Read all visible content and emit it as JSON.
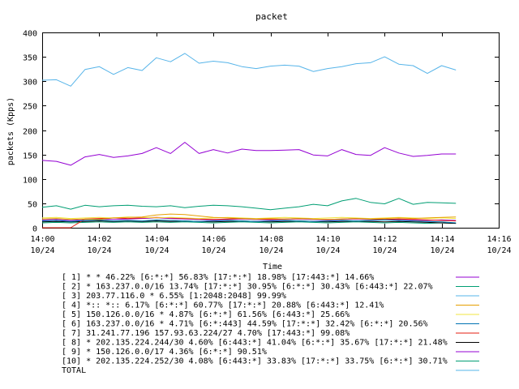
{
  "chart_data": {
    "type": "line",
    "title": "packet",
    "xlabel": "Time",
    "ylabel": "packets (Kpps)",
    "ylim": [
      0,
      400
    ],
    "yticks": [
      "0",
      "50",
      "100",
      "150",
      "200",
      "250",
      "300",
      "350",
      "400"
    ],
    "xticks": [
      {
        "time": "14:00",
        "date": "10/24"
      },
      {
        "time": "14:02",
        "date": "10/24"
      },
      {
        "time": "14:04",
        "date": "10/24"
      },
      {
        "time": "14:06",
        "date": "10/24"
      },
      {
        "time": "14:08",
        "date": "10/24"
      },
      {
        "time": "14:10",
        "date": "10/24"
      },
      {
        "time": "14:12",
        "date": "10/24"
      },
      {
        "time": "14:14",
        "date": "10/24"
      },
      {
        "time": "14:16",
        "date": "10/24"
      }
    ],
    "x_minutes": [
      0,
      0.5,
      1,
      1.5,
      2,
      2.5,
      3,
      3.5,
      4,
      4.5,
      5,
      5.5,
      6,
      6.5,
      7,
      7.5,
      8,
      8.5,
      9,
      9.5,
      10,
      10.5,
      11,
      11.5,
      12,
      12.5,
      13,
      13.5,
      14,
      14.5
    ],
    "series": [
      {
        "name": "[ 1] * * 46.22%  [6:*:*] 56.83% [17:*:*] 18.98% [17:443:*] 14.66%",
        "color": "#9400d3",
        "values": [
          138,
          136,
          128,
          145,
          150,
          144,
          147,
          152,
          164,
          152,
          175,
          152,
          160,
          153,
          161,
          158,
          158,
          159,
          160,
          149,
          147,
          160,
          150,
          148,
          164,
          153,
          146,
          148,
          151,
          151
        ]
      },
      {
        "name": "[ 2] * 163.237.0.0/16 13.74%  [17:*:*] 30.95% [6:*:*] 30.43% [6:443:*] 22.07%",
        "color": "#009e73",
        "values": [
          42,
          45,
          38,
          46,
          43,
          45,
          46,
          44,
          43,
          45,
          41,
          44,
          46,
          45,
          43,
          40,
          37,
          40,
          43,
          48,
          45,
          55,
          60,
          52,
          49,
          60,
          48,
          52,
          51,
          50
        ]
      },
      {
        "name": "[ 3] 203.77.116.0 * 6.55%  [1:2048:2048] 99.99%",
        "color": "#56b4e9",
        "values": [
          302,
          303,
          290,
          324,
          330,
          314,
          328,
          322,
          348,
          340,
          357,
          337,
          341,
          338,
          330,
          326,
          331,
          333,
          331,
          320,
          326,
          330,
          336,
          338,
          350,
          335,
          332,
          316,
          332,
          323
        ]
      },
      {
        "name": "[ 4] *:: *:: 6.17%  [6:*:*] 60.77% [17:*:*] 20.88% [6:443:*] 12.41%",
        "color": "#e69f00",
        "values": [
          18,
          19,
          17,
          18,
          17,
          20,
          21,
          22,
          26,
          28,
          27,
          24,
          21,
          20,
          19,
          18,
          19,
          18,
          19,
          18,
          17,
          18,
          19,
          18,
          19,
          20,
          19,
          20,
          21,
          22
        ]
      },
      {
        "name": "[ 5] 150.126.0.0/16 * 4.87%  [6:*:*] 61.56% [6:443:*] 25.66%",
        "color": "#f0e442",
        "values": [
          20,
          21,
          19,
          20,
          21,
          20,
          22,
          21,
          20,
          21,
          20,
          19,
          20,
          21,
          20,
          19,
          20,
          21,
          20,
          19,
          20,
          21,
          20,
          19,
          20,
          21,
          20,
          19,
          20,
          19
        ]
      },
      {
        "name": "[ 6] 163.237.0.0/16 * 4.71%  [6:*:443] 44.59% [17:*:*] 32.42% [6:*:*] 20.56%",
        "color": "#0072b2",
        "values": [
          14,
          15,
          13,
          15,
          16,
          14,
          15,
          14,
          16,
          15,
          14,
          13,
          14,
          15,
          14,
          13,
          14,
          15,
          14,
          13,
          14,
          15,
          14,
          15,
          16,
          15,
          14,
          13,
          12,
          10
        ]
      },
      {
        "name": "[ 7] 31.241.77.196 157.93.63.224/27 4.70%  [17:443:*] 99.08%",
        "color": "#e51e10",
        "values": [
          0,
          0,
          0,
          18,
          19,
          20,
          19,
          20,
          21,
          20,
          19,
          18,
          17,
          18,
          19,
          18,
          17,
          18,
          19,
          18,
          17,
          18,
          19,
          18,
          17,
          18,
          17,
          16,
          15,
          14
        ]
      },
      {
        "name": "[ 8] * 202.135.224.244/30 4.60%  [6:443:*] 41.04% [6:*:*] 35.67% [17:*:*] 21.48%",
        "color": "#000000",
        "values": [
          12,
          13,
          12,
          13,
          14,
          13,
          14,
          13,
          14,
          13,
          14,
          13,
          12,
          13,
          14,
          13,
          12,
          13,
          14,
          13,
          12,
          13,
          14,
          13,
          12,
          13,
          12,
          11,
          10,
          9
        ]
      },
      {
        "name": "[ 9] * 150.126.0.0/17 4.36%  [6:*:*] 90.51%",
        "color": "#9400d3",
        "values": [
          16,
          17,
          15,
          17,
          18,
          17,
          18,
          19,
          20,
          19,
          18,
          17,
          16,
          17,
          18,
          17,
          16,
          17,
          18,
          17,
          16,
          17,
          18,
          17,
          16,
          17,
          16,
          15,
          16,
          15
        ]
      },
      {
        "name": "[10] * 202.135.224.252/30 4.08%  [6:443:*] 33.83% [17:*:*] 33.75% [6:*:*] 30.71%",
        "color": "#009e73",
        "values": [
          10,
          11,
          10,
          11,
          12,
          11,
          12,
          11,
          12,
          11,
          12,
          11,
          10,
          11,
          12,
          11,
          10,
          11,
          12,
          11,
          10,
          11,
          12,
          11,
          10,
          11,
          10,
          9,
          10,
          9
        ]
      },
      {
        "name": "TOTAL",
        "color": "#56b4e9",
        "values": []
      }
    ],
    "grid": false,
    "legend_position": "bottom"
  }
}
